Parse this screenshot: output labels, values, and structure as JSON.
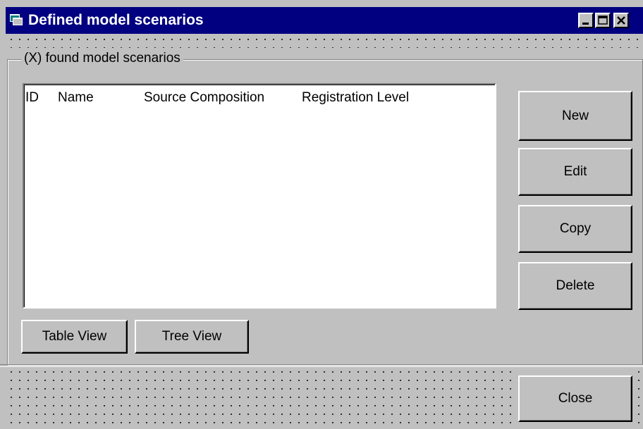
{
  "window": {
    "title": "Defined model scenarios",
    "icon": "window-app-icon",
    "controls": [
      "minimize-icon",
      "maximize-icon",
      "close-icon"
    ]
  },
  "frame": {
    "label": "(X) found model scenarios"
  },
  "listview": {
    "columns": [
      "ID",
      "Name",
      "Source Composition",
      "Registration Level"
    ],
    "rows": []
  },
  "buttons": {
    "new": "New",
    "edit": "Edit",
    "copy": "Copy",
    "delete": "Delete",
    "table_view": "Table View",
    "tree_view": "Tree View",
    "close": "Close"
  },
  "colors": {
    "titlebar": "#000080",
    "face": "#c0c0c0"
  }
}
